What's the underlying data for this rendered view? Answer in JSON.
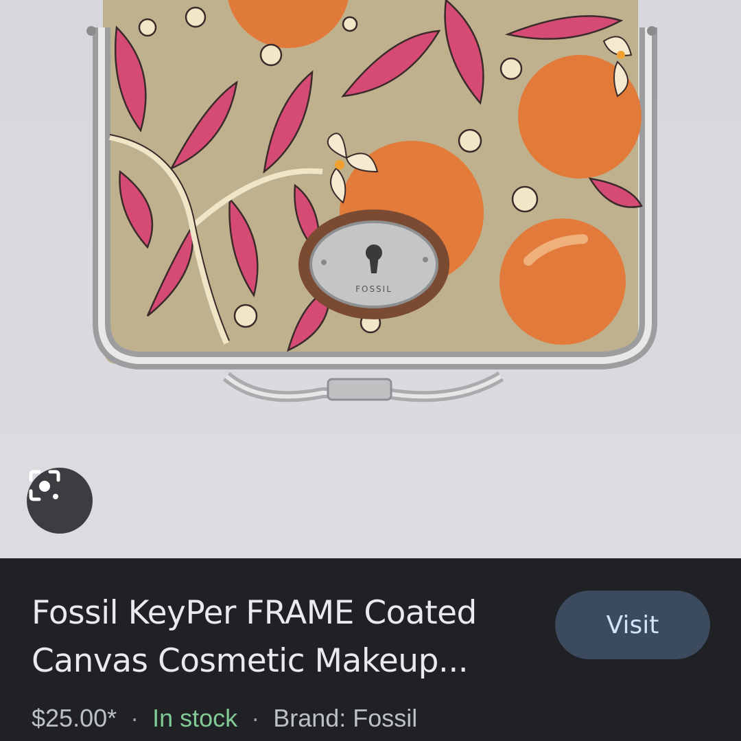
{
  "product": {
    "title_line1": "Fossil KeyPer FRAME Coated",
    "title_line2": "Canvas Cosmetic Makeup...",
    "price": "$25.00*",
    "availability": "In stock",
    "brand": "Brand: Fossil",
    "separator": "·"
  },
  "actions": {
    "visit_label": "Visit",
    "lens_icon": "google-lens-icon"
  },
  "image": {
    "subject": "product-photo",
    "emblem_text": "FOSSIL"
  },
  "colors": {
    "background": "#202124",
    "title": "#e8eaed",
    "stock": "#81c995",
    "visit_bg": "#3c4a5e",
    "visit_text": "#d2e3fc"
  }
}
